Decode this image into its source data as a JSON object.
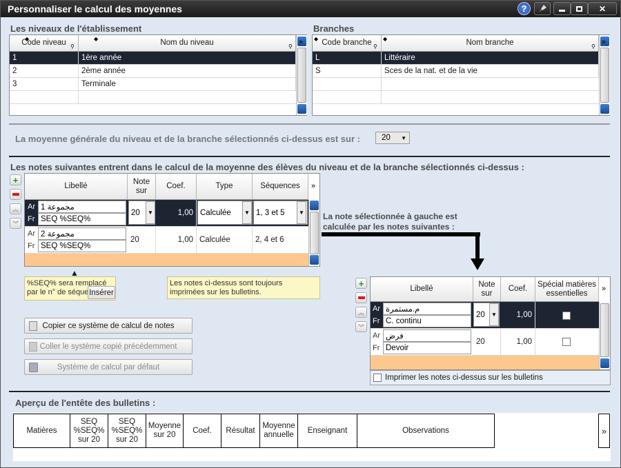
{
  "window": {
    "title": "Personnaliser le calcul des moyennes"
  },
  "niveaux": {
    "heading": "Les niveaux de l'établissement",
    "columns": [
      "Code niveau",
      "Nom du niveau"
    ],
    "rows": [
      {
        "code": "1",
        "nom": "1ère année"
      },
      {
        "code": "2",
        "nom": "2ème année"
      },
      {
        "code": "3",
        "nom": "Terminale"
      }
    ]
  },
  "branches": {
    "heading": "Branches",
    "columns": [
      "Code branche",
      "Nom branche"
    ],
    "rows": [
      {
        "code": "L",
        "nom": "Littéraire"
      },
      {
        "code": "S",
        "nom": "Sces de la nat. et de la vie"
      }
    ]
  },
  "moyenne": {
    "label": "La moyenne générale du niveau et de la branche sélectionnés ci-dessus est sur :",
    "value": "20"
  },
  "notes": {
    "heading": "Les notes suivantes entrent dans le calcul de la moyenne des élèves du niveau et de la branche sélectionnés ci-dessus :",
    "columns": {
      "libelle": "Libellé",
      "note_sur": "Note sur",
      "coef": "Coef.",
      "type": "Type",
      "sequences": "Séquences"
    },
    "rows": [
      {
        "ar_label": "Ar",
        "ar": "مجموعة 1",
        "fr_label": "Fr",
        "fr": "SEQ %SEQ%",
        "note_sur": "20",
        "coef": "1,00",
        "type": "Calculée",
        "sequences": "1, 3 et 5"
      },
      {
        "ar_label": "Ar",
        "ar": "مجموعة 2",
        "fr_label": "Fr",
        "fr": "SEQ %SEQ%",
        "note_sur": "20",
        "coef": "1,00",
        "type": "Calculée",
        "sequences": "2, 4 et 6"
      }
    ]
  },
  "tips": {
    "seq": "%SEQ% sera remplacé par le n° de séquence",
    "inserer": "Insérer",
    "printed": "Les notes ci-dessus sont toujours imprimées sur les bulletins."
  },
  "calc_note": "La note sélectionnée à gauche est calculée par les notes suivantes :",
  "buttons": {
    "copier": "Copier ce système de calcul de notes",
    "coller": "Coller le système copié précédemment",
    "defaut": "Système de calcul par défaut"
  },
  "subnotes": {
    "columns": {
      "libelle": "Libellé",
      "note_sur": "Note sur",
      "coef": "Coef.",
      "special": "Spécial matières essentielles"
    },
    "rows": [
      {
        "ar_label": "Ar",
        "ar": "م.مستمرة",
        "fr_label": "Fr",
        "fr": "C. continu",
        "note_sur": "20",
        "coef": "1,00"
      },
      {
        "ar_label": "Ar",
        "ar": "فرض",
        "fr_label": "Fr",
        "fr": "Devoir",
        "note_sur": "20",
        "coef": "1,00"
      }
    ],
    "print_label": "Imprimer les notes ci-dessus sur les bulletins"
  },
  "apercu": {
    "heading": "Aperçu de l'entête des bulletins :",
    "columns": [
      "Matières",
      "SEQ %SEQ% sur 20",
      "SEQ %SEQ% sur 20",
      "Moyenne sur 20",
      "Coef.",
      "Résultat",
      "Moyenne annuelle",
      "Enseignant",
      "Observations"
    ]
  }
}
